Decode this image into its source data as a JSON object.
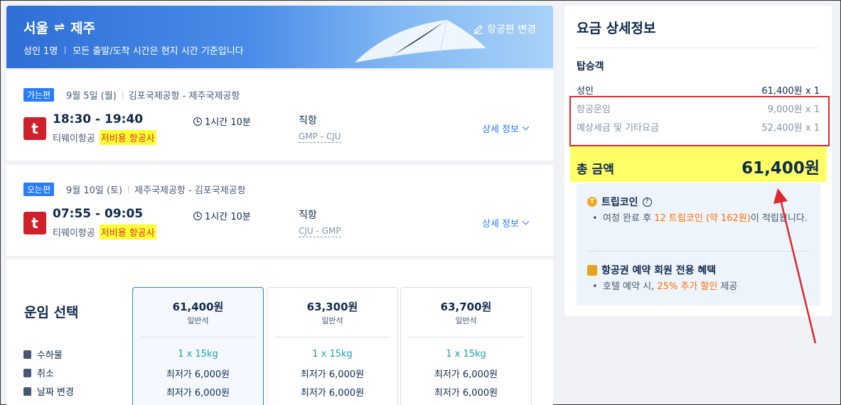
{
  "header": {
    "origin": "서울",
    "destination": "제주",
    "swap_icon": "⇌",
    "passengers": "성인 1명",
    "time_note": "모든 출발/도착 시간은 현지 시간 기준입니다",
    "change_label": "항공편 변경"
  },
  "outbound": {
    "badge": "가는편",
    "date": "9월 5일 (월)",
    "route": "김포국제공항 - 제주국제공항",
    "times": "18:30 - 19:40",
    "airline": "티웨이항공",
    "lcc_tag": "저비용 항공사",
    "duration": "1시간 10분",
    "stops": "직항",
    "codes": "GMP - CJU",
    "detail_label": "상세 정보"
  },
  "inbound": {
    "badge": "오는편",
    "date": "9월 10일 (토)",
    "route": "제주국제공항 - 김포국제공항",
    "times": "07:55 - 09:05",
    "airline": "티웨이항공",
    "lcc_tag": "저비용 항공사",
    "duration": "1시간 10분",
    "stops": "직항",
    "codes": "CJU - GMP",
    "detail_label": "상세 정보"
  },
  "fare_select": {
    "title": "운임 선택",
    "features": [
      "수하물",
      "취소",
      "날짜 변경"
    ],
    "options": [
      {
        "price": "61,400원",
        "class": "일반석",
        "baggage": "1 x 15kg",
        "cancel": "최저가 6,000원",
        "change": "최저가 6,000원",
        "selected": true
      },
      {
        "price": "63,300원",
        "class": "일반석",
        "baggage": "1 x 15kg",
        "cancel": "최저가 6,000원",
        "change": "최저가 6,000원",
        "selected": false
      },
      {
        "price": "63,700원",
        "class": "일반석",
        "baggage": "1 x 15kg",
        "cancel": "최저가 6,000원",
        "change": "최저가 6,000원",
        "selected": false
      }
    ]
  },
  "price_panel": {
    "title": "요금 상세정보",
    "pax_title": "탑승객",
    "adult_label": "성인",
    "adult_value": "61,400원 x 1",
    "fare_label": "항공운임",
    "fare_value": "9,000원 x 1",
    "tax_label": "예상세금 및 기타요금",
    "tax_value": "52,400원 x 1",
    "total_label": "총 금액",
    "total_value": "61,400원",
    "coin_title": "트립코인",
    "coin_icon": "T",
    "coin_text_pre": "여정 완료 후 ",
    "coin_text_hl": "12 트립코인 (약 162원)",
    "coin_text_post": "이 적립됩니다.",
    "member_title": "항공권 예약 회원 전용 혜택",
    "member_text_pre": "호텔 예약 시, ",
    "member_text_hl": "25% 추가 할인",
    "member_text_post": " 제공"
  },
  "colors": {
    "accent": "#287dfa",
    "highlight_yellow": "#ffff66",
    "annotation_red": "#e0262d",
    "lcc_red": "#e03030"
  }
}
